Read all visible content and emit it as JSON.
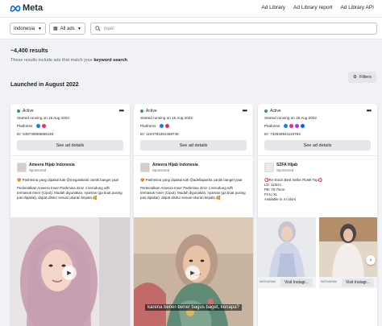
{
  "header": {
    "brand": "Meta",
    "nav": [
      "Ad Library",
      "Ad Library report",
      "Ad Library API"
    ]
  },
  "filters": {
    "country": "Indonesia",
    "ad_type": "All ads",
    "search_value": "hijab",
    "filters_label": "Filters"
  },
  "results": {
    "count": "~4,400 results",
    "note_prefix": "These results include ads that match your",
    "note_keyword": "keyword search",
    "note_suffix": "."
  },
  "section": {
    "title": "Launched in August 2022"
  },
  "colors": {
    "active": "#31a24c",
    "facebook": "#1877f2",
    "instagram": "#e1306c",
    "messenger": "#a334fa",
    "audience": "#0064e0"
  },
  "ads": [
    {
      "status": "Active",
      "started": "Started running on 15 Aug 2022",
      "platforms_label": "Platforms",
      "id": "ID: 548739556855193",
      "see_details": "See ad details",
      "page_name": "Ameera Hijab Indonesia",
      "sponsored": "Sponsored",
      "text_1": "😍 Pashmina yang dipakai kak @megaiskanti cantik banget yaa!",
      "text_2": "Perkenalkan Ameera Inner Pashmina 2in1! 1 kerudung sdh termasuk Inner (Ciput). Mudah digunakan, nyaman (ga buat pusing pas dipakai), dapat disitur sesuai ukuran kepala 🥰"
    },
    {
      "status": "Active",
      "started": "Started running on 15 Aug 2022",
      "platforms_label": "Platforms",
      "id": "ID: 1194781281458745",
      "see_details": "See ad details",
      "page_name": "Ameera Hijab Indonesia",
      "sponsored": "Sponsored",
      "text_1": "😍 Pashmina yang dipakai kak @adellapasha cantik banget yaa!",
      "text_2": "Perkenalkan Ameera Inner Pashmina 2in1! 1 kerudung sdh termasuk Inner (Ciput). Mudah digunakan, nyaman (ga buat pusing pas dipakai), dapat disitur sesuai ukuran kepala 🥰",
      "caption": "karena bener-bener bagus baget, kenapa?"
    },
    {
      "status": "Active",
      "started": "Started running on 15 Aug 2022",
      "platforms_label": "Platforms",
      "id": "ID: 732828941116784",
      "see_details": "See ad details",
      "page_name": "SZFA Hijab",
      "sponsored": "Sponsored",
      "text_1": "⭕Re-Stock Best Seller RUMI Top⭕",
      "text_2": "LD: 110cm",
      "text_3": "PB: 70-75cm",
      "text_4": "Fit to XL",
      "text_5": "Available in 4 colors",
      "cta_source": "INSTAGRAM",
      "cta_label": "Visit Instagr..."
    }
  ]
}
